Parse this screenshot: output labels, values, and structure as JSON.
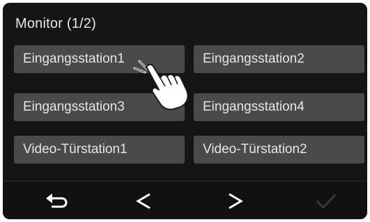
{
  "header": {
    "title": "Monitor (1/2)"
  },
  "stations": [
    {
      "label": "Eingangsstation1"
    },
    {
      "label": "Eingangsstation2"
    },
    {
      "label": "Eingangsstation3"
    },
    {
      "label": "Eingangsstation4"
    },
    {
      "label": "Video-Türstation1"
    },
    {
      "label": "Video-Türstation2"
    }
  ],
  "footer": {
    "icons": [
      "back-arrow-icon",
      "previous-icon",
      "next-icon",
      "confirm-check-icon"
    ],
    "confirm_enabled": false
  },
  "colors": {
    "background": "#151515",
    "button": "#4a4a4a",
    "text": "#e6e6e6",
    "icon": "#ffffff",
    "icon_disabled": "#3a3a3a"
  }
}
